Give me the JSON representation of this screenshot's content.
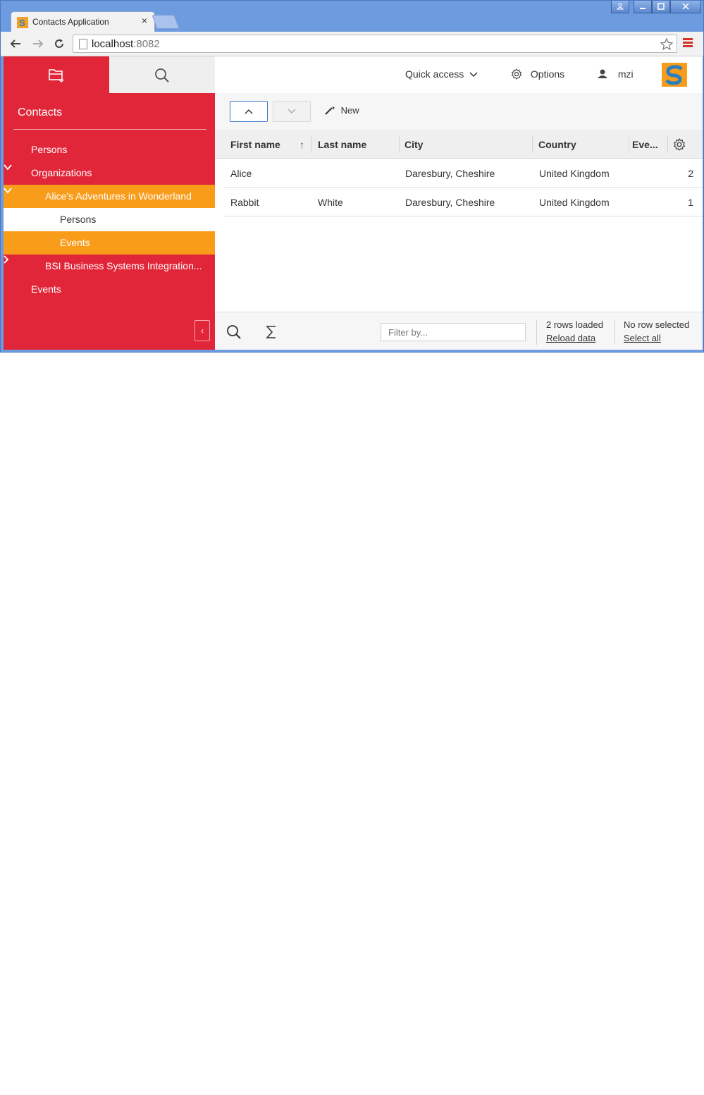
{
  "browser": {
    "tab_title": "Contacts Application",
    "tab_close": "×",
    "url_host": "localhost",
    "url_port": ":8082"
  },
  "sidebar": {
    "title": "Contacts",
    "collapse_glyph": "‹",
    "tree": [
      {
        "label": "Persons",
        "level": 1,
        "state": "normal"
      },
      {
        "label": "Organizations",
        "level": 1,
        "state": "expanded"
      },
      {
        "label": "Alice's Adventures in Wonderland",
        "level": 2,
        "state": "selected-parent"
      },
      {
        "label": "Persons",
        "level": 3,
        "state": "plain"
      },
      {
        "label": "Events",
        "level": 3,
        "state": "selected"
      },
      {
        "label": "BSI Business Systems Integration...",
        "level": 2,
        "state": "collapsed"
      },
      {
        "label": "Events",
        "level": 1,
        "state": "normal"
      }
    ]
  },
  "header": {
    "quick_access": "Quick access",
    "options": "Options",
    "user": "mzi"
  },
  "menubar": {
    "new_label": "New"
  },
  "table": {
    "columns": [
      "First name",
      "Last name",
      "City",
      "Country",
      "Eve..."
    ],
    "sort_indicator": "↑",
    "rows": [
      [
        "Alice",
        "",
        "Daresbury, Cheshire",
        "United Kingdom",
        "2"
      ],
      [
        "Rabbit",
        "White",
        "Daresbury, Cheshire",
        "United Kingdom",
        "1"
      ]
    ]
  },
  "footer": {
    "filter_placeholder": "Filter by...",
    "rows_loaded": "2 rows loaded",
    "reload_data": "Reload data",
    "selection_status": "No row selected",
    "select_all": "Select all"
  },
  "colors": {
    "sidebar_red": "#e2263a",
    "selected_orange": "#f99c1a",
    "accent_blue": "#3a78c9"
  }
}
